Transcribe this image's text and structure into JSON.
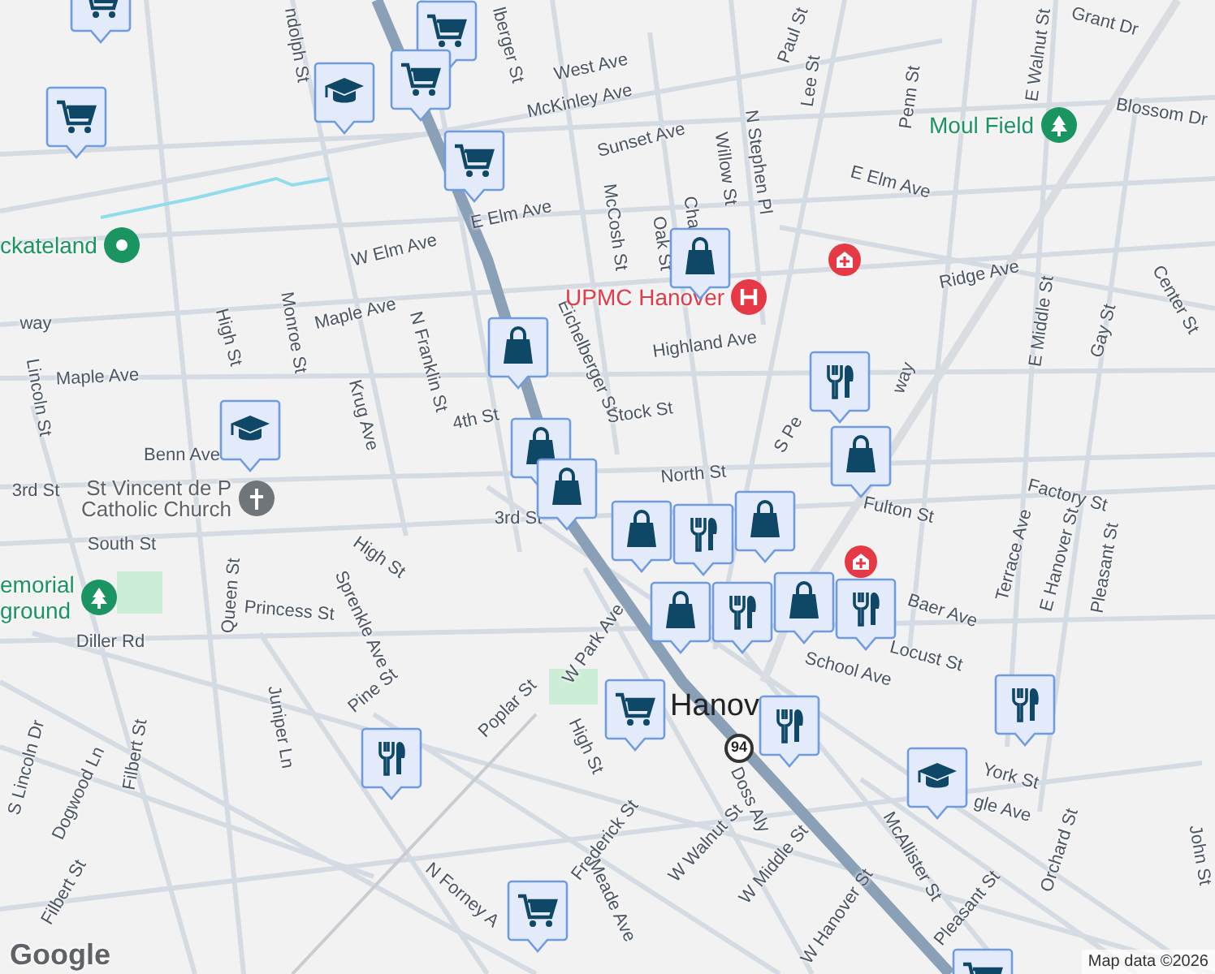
{
  "map": {
    "street_labels": [
      "ndolph St",
      "lberger St",
      "West Ave",
      "McKinley Ave",
      "Sunset Ave",
      "E Elm Ave",
      "W Elm Ave",
      "Maple Ave",
      "Maple Ave",
      "High St",
      "Monroe St",
      "Krug Ave",
      "N Franklin St",
      "4th St",
      "Eichelberger St",
      "McCosh St",
      "Oak St",
      "Cha",
      "Willow St",
      "N Stephen Pl",
      "Lee St",
      "Paul St",
      "Penn St",
      "E Walnut St",
      "Grant Dr",
      "Blossom Dr",
      "E Elm Ave",
      "Ridge Ave",
      "E Middle St",
      "Gay St",
      "Center St",
      "Highland Ave",
      "Stock St",
      "S Pe",
      "way",
      "way",
      "North St",
      "Fulton St",
      "Factory St",
      "Terrace Ave",
      "E Hanover St",
      "Pleasant St",
      "Baer Ave",
      "Locust St",
      "School Ave",
      "York St",
      "gle Ave",
      "McAllister St",
      "Pleasant St",
      "Orchard St",
      "John St",
      "W Middle St",
      "W Walnut St",
      "Doss Aly",
      "W Hanover St",
      "Frederick St",
      "Meade Ave",
      "N Forney A",
      "High St",
      "W Park Ave",
      "Poplar St",
      "Pine St",
      "Sprenkle Ave",
      "Juniper Ln",
      "Queen St",
      "Princess St",
      "Diller Rd",
      "South St",
      "3rd St",
      "3rd St",
      "High St",
      "Benn Ave",
      "Filbert St",
      "S Lincoln Dr",
      "Dogwood Ln",
      "Filbert St",
      "Lincoln St",
      "Hanov"
    ],
    "places": [
      {
        "kind": "hospital",
        "lines": [
          "UPMC Hanover"
        ]
      },
      {
        "kind": "park",
        "lines": [
          "Moul Field"
        ]
      },
      {
        "kind": "pin",
        "lines": [
          "ckateland"
        ]
      },
      {
        "kind": "church",
        "lines": [
          "St Vincent de P",
          "Catholic Church"
        ]
      },
      {
        "kind": "park",
        "lines": [
          "emorial",
          "ground"
        ]
      }
    ],
    "markers": [
      {
        "kind": "cart"
      },
      {
        "kind": "cart"
      },
      {
        "kind": "school"
      },
      {
        "kind": "cart"
      },
      {
        "kind": "cart"
      },
      {
        "kind": "cart"
      },
      {
        "kind": "shopping"
      },
      {
        "kind": "school"
      },
      {
        "kind": "shopping"
      },
      {
        "kind": "shopping"
      },
      {
        "kind": "shopping"
      },
      {
        "kind": "restaurant"
      },
      {
        "kind": "shopping"
      },
      {
        "kind": "shopping"
      },
      {
        "kind": "restaurant"
      },
      {
        "kind": "shopping"
      },
      {
        "kind": "restaurant"
      },
      {
        "kind": "restaurant"
      },
      {
        "kind": "shopping"
      },
      {
        "kind": "shopping"
      },
      {
        "kind": "cart"
      },
      {
        "kind": "restaurant"
      },
      {
        "kind": "restaurant"
      },
      {
        "kind": "school"
      },
      {
        "kind": "restaurant"
      },
      {
        "kind": "cart"
      },
      {
        "kind": "cart"
      }
    ],
    "route_shields": [
      "94"
    ],
    "logo": "Google",
    "attribution": "Map data ©2026"
  }
}
